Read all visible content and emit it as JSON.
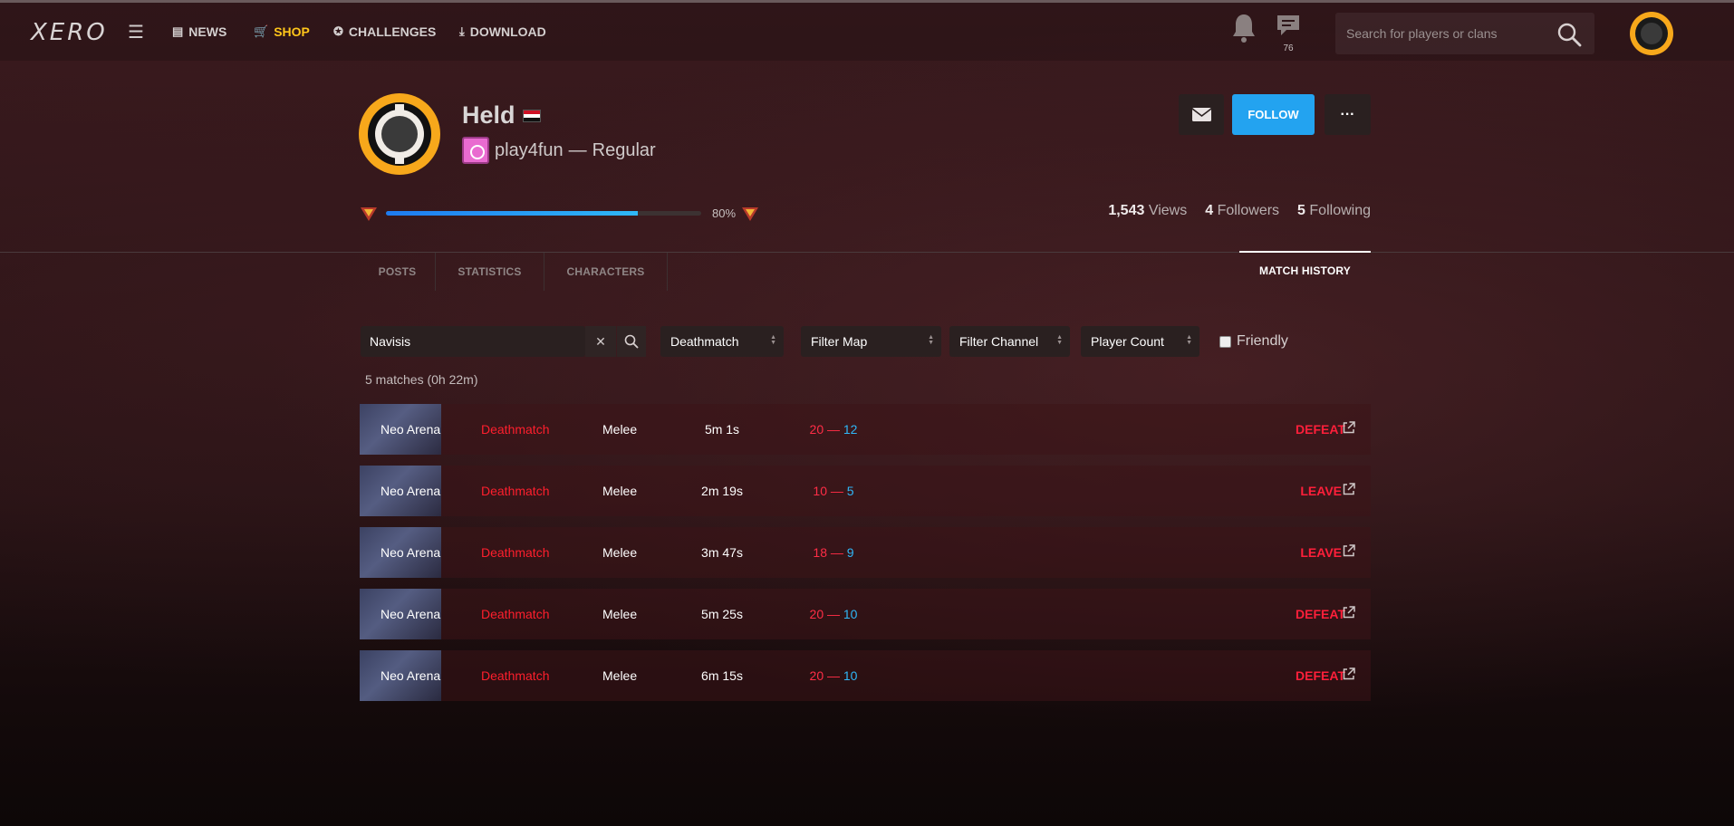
{
  "nav": {
    "logo": "XERO",
    "links": [
      {
        "label": "NEWS",
        "icon": "newspaper-icon"
      },
      {
        "label": "SHOP",
        "icon": "cart-icon"
      },
      {
        "label": "CHALLENGES",
        "icon": "medal-icon"
      },
      {
        "label": "DOWNLOAD",
        "icon": "download-icon"
      }
    ],
    "message_count": "76",
    "search_placeholder": "Search for players or clans"
  },
  "profile": {
    "name": "Held",
    "clan": "play4fun",
    "clan_sep": "—",
    "clan_role": "Regular",
    "xp_percent": 80,
    "xp_label": "80%",
    "follow_label": "FOLLOW",
    "more_label": "···",
    "stats": {
      "views": "1,543",
      "views_label": "Views",
      "followers": "4",
      "followers_label": "Followers",
      "following": "5",
      "following_label": "Following"
    }
  },
  "tabs": [
    "POSTS",
    "STATISTICS",
    "CHARACTERS",
    "MATCH HISTORY"
  ],
  "active_tab": "MATCH HISTORY",
  "filters": {
    "player_value": "Navisis",
    "mode": "Deathmatch",
    "map": "Filter Map",
    "channel": "Filter Channel",
    "player_count": "Player Count",
    "friendly_label": "Friendly"
  },
  "summary": "5 matches (0h 22m)",
  "matches": [
    {
      "map": "Neo Arena",
      "mode": "Deathmatch",
      "type": "Melee",
      "duration": "5m 1s",
      "score_a": "20",
      "score_b": "12",
      "result": "DEFEAT"
    },
    {
      "map": "Neo Arena",
      "mode": "Deathmatch",
      "type": "Melee",
      "duration": "2m 19s",
      "score_a": "10",
      "score_b": "5",
      "result": "LEAVE"
    },
    {
      "map": "Neo Arena",
      "mode": "Deathmatch",
      "type": "Melee",
      "duration": "3m 47s",
      "score_a": "18",
      "score_b": "9",
      "result": "LEAVE"
    },
    {
      "map": "Neo Arena",
      "mode": "Deathmatch",
      "type": "Melee",
      "duration": "5m 25s",
      "score_a": "20",
      "score_b": "10",
      "result": "DEFEAT"
    },
    {
      "map": "Neo Arena",
      "mode": "Deathmatch",
      "type": "Melee",
      "duration": "6m 15s",
      "score_a": "20",
      "score_b": "10",
      "result": "DEFEAT"
    }
  ],
  "colors": {
    "accent": "#23a3f0",
    "shop": "#ffc61a",
    "red": "#ff1f2d",
    "blue": "#2fb7f7",
    "avatar_ring": "#f7a81b"
  }
}
